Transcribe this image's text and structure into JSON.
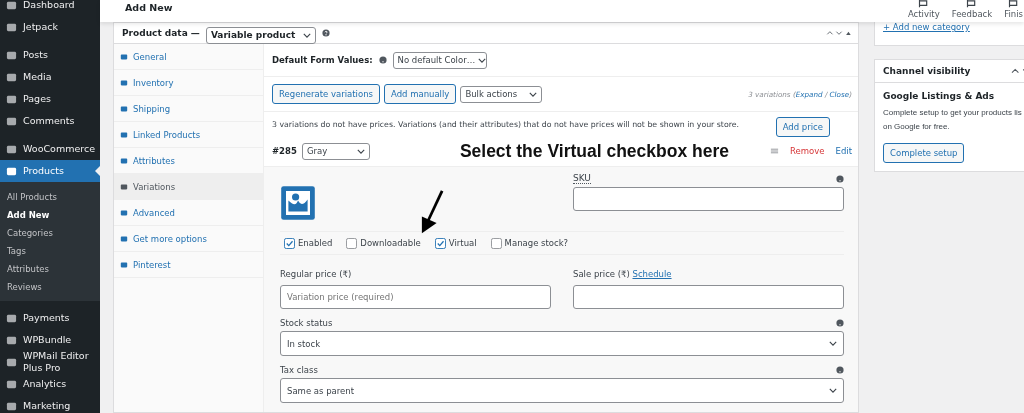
{
  "sidebar": {
    "items": [
      {
        "label": "Dashboard",
        "selected": false
      },
      {
        "label": "Jetpack",
        "selected": false
      },
      {
        "label": "Posts",
        "selected": false
      },
      {
        "label": "Media",
        "selected": false
      },
      {
        "label": "Pages",
        "selected": false
      },
      {
        "label": "Comments",
        "selected": false
      },
      {
        "label": "WooCommerce",
        "selected": false
      },
      {
        "label": "Products",
        "selected": true,
        "children": [
          {
            "label": "All Products",
            "selected": false
          },
          {
            "label": "Add New",
            "selected": true
          },
          {
            "label": "Categories",
            "selected": false
          },
          {
            "label": "Tags",
            "selected": false
          },
          {
            "label": "Attributes",
            "selected": false
          },
          {
            "label": "Reviews",
            "selected": false
          }
        ]
      },
      {
        "label": "Payments",
        "selected": false
      },
      {
        "label": "WPBundle",
        "selected": false
      },
      {
        "label": "WPMail Editor Plus Pro",
        "selected": false
      },
      {
        "label": "Analytics",
        "selected": false
      },
      {
        "label": "Marketing",
        "selected": false
      }
    ]
  },
  "header": {
    "title": "Add New",
    "actions": [
      "Activity",
      "Feedback",
      "Finis"
    ]
  },
  "product_data": {
    "label": "Product data —",
    "type": "Variable product",
    "tabs": [
      {
        "label": "General",
        "selected": false
      },
      {
        "label": "Inventory",
        "selected": false
      },
      {
        "label": "Shipping",
        "selected": false
      },
      {
        "label": "Linked Products",
        "selected": false
      },
      {
        "label": "Attributes",
        "selected": false
      },
      {
        "label": "Variations",
        "selected": true
      },
      {
        "label": "Advanced",
        "selected": false
      },
      {
        "label": "Get more options",
        "selected": false
      },
      {
        "label": "Pinterest",
        "selected": false
      }
    ],
    "default_form_values": {
      "label": "Default Form Values:",
      "value": "No default Color…"
    },
    "buttons": [
      "Regenerate variations",
      "Add manually"
    ],
    "bulk_actions": "Bulk actions",
    "count": {
      "text": "3 variations (",
      "expand": "Expand",
      "sep": " / ",
      "close": "Close",
      "end": ")"
    },
    "notice": "3 variations do not have prices. Variations (and their attributes) that do not have prices will not be shown in your store.",
    "add_price": "Add price",
    "variation": {
      "id": "#285",
      "value": "Gray",
      "annotation": "Select the Virtual checkbox here",
      "remove": "Remove",
      "edit": "Edit",
      "sku_label": "SKU",
      "options": [
        {
          "label": "Enabled",
          "checked": true
        },
        {
          "label": "Downloadable",
          "checked": false
        },
        {
          "label": "Virtual",
          "checked": true
        },
        {
          "label": "Manage stock?",
          "checked": false
        }
      ],
      "regular_price_label": "Regular price (₹)",
      "regular_price_placeholder": "Variation price (required)",
      "sale_price_label": "Sale price (₹)",
      "schedule": "Schedule",
      "stock_status_label": "Stock status",
      "stock_status": "In stock",
      "tax_class_label": "Tax class",
      "tax_class": "Same as parent"
    }
  },
  "categories_box": {
    "link": "+ Add new category"
  },
  "channel_visibility": {
    "title": "Channel visibility",
    "heading": "Google Listings & Ads",
    "text": [
      "Complete setup to get your products lis",
      "on Google for free."
    ],
    "button": "Complete setup"
  }
}
